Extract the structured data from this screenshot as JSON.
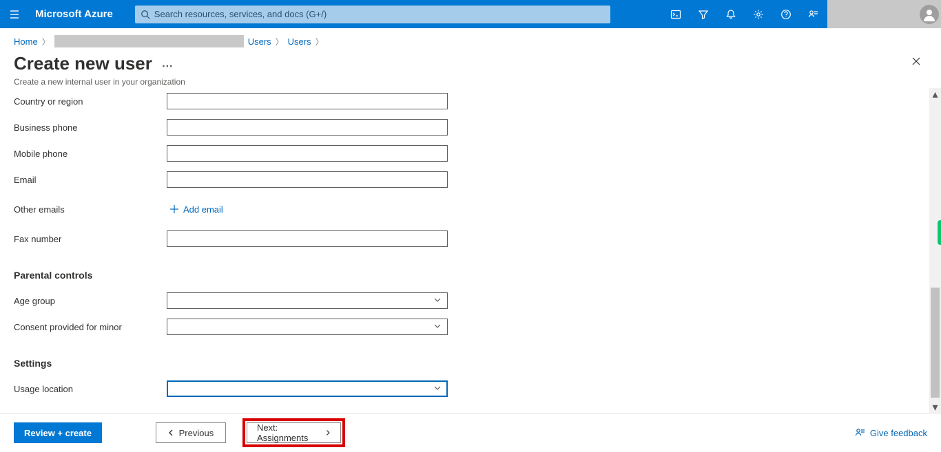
{
  "brand": "Microsoft Azure",
  "search": {
    "placeholder": "Search resources, services, and docs (G+/)"
  },
  "breadcrumb": {
    "home": "Home",
    "users1": "Users",
    "users2": "Users"
  },
  "header": {
    "title": "Create new user",
    "subtitle": "Create a new internal user in your organization",
    "more": "⋯"
  },
  "form": {
    "labels": {
      "country": "Country or region",
      "business_phone": "Business phone",
      "mobile_phone": "Mobile phone",
      "email": "Email",
      "other_emails": "Other emails",
      "add_email": "Add email",
      "fax": "Fax number",
      "parental_controls": "Parental controls",
      "age_group": "Age group",
      "consent_minor": "Consent provided for minor",
      "settings": "Settings",
      "usage_location": "Usage location"
    },
    "values": {
      "country": "",
      "business_phone": "",
      "mobile_phone": "",
      "email": "",
      "fax": "",
      "age_group": "",
      "consent_minor": "",
      "usage_location": ""
    }
  },
  "footer": {
    "review_create": "Review + create",
    "previous": "Previous",
    "next": "Next: Assignments",
    "feedback": "Give feedback"
  }
}
